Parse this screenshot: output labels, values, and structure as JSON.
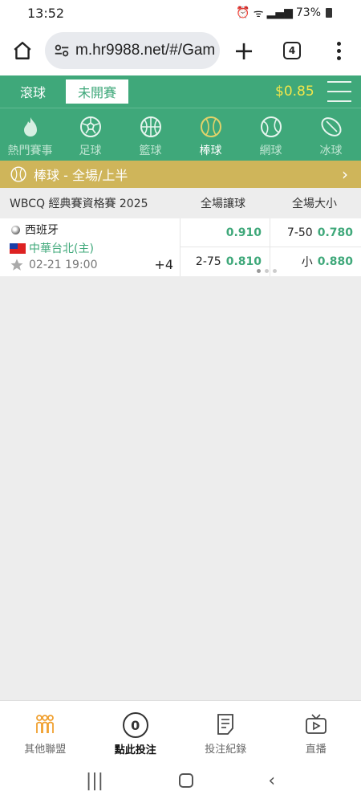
{
  "status_bar": {
    "time": "13:52",
    "battery": "73%"
  },
  "browser": {
    "url": "m.hr9988.net/#/Gam",
    "tab_count": "4"
  },
  "header": {
    "live_label": "滾球",
    "prematch_label": "未開賽",
    "balance": "$0.85"
  },
  "sports": [
    {
      "label": "熱門賽事",
      "icon": "fire-icon"
    },
    {
      "label": "足球",
      "icon": "soccer-ball-icon"
    },
    {
      "label": "籃球",
      "icon": "basketball-icon"
    },
    {
      "label": "棒球",
      "icon": "baseball-icon"
    },
    {
      "label": "網球",
      "icon": "tennis-ball-icon"
    },
    {
      "label": "冰球",
      "icon": "hockey-puck-icon"
    }
  ],
  "section_title": "棒球 - 全場/上半",
  "league": {
    "name": "WBCQ 經典賽資格賽 2025",
    "col1": "全場讓球",
    "col2": "全場大小"
  },
  "match": {
    "team1": "西班牙",
    "team2": "中華台北(主)",
    "datetime": "02-21 19:00",
    "more": "+4",
    "handicap_top_price": "0.910",
    "handicap_bottom_line": "2-75",
    "handicap_bottom_price": "0.810",
    "ou_top_line": "7-50",
    "ou_top_price": "0.780",
    "ou_bottom_line": "小",
    "ou_bottom_price": "0.880"
  },
  "bottom_nav": {
    "other_leagues": "其他聯盟",
    "bet_slip": "點此投注",
    "bet_slip_count": "0",
    "bet_history": "投注紀錄",
    "live_stream": "直播"
  },
  "colors": {
    "brand_green": "#3fa87a",
    "gold": "#cfb55a",
    "balance_yellow": "#f3e64a",
    "nav_orange": "#f0a030"
  }
}
